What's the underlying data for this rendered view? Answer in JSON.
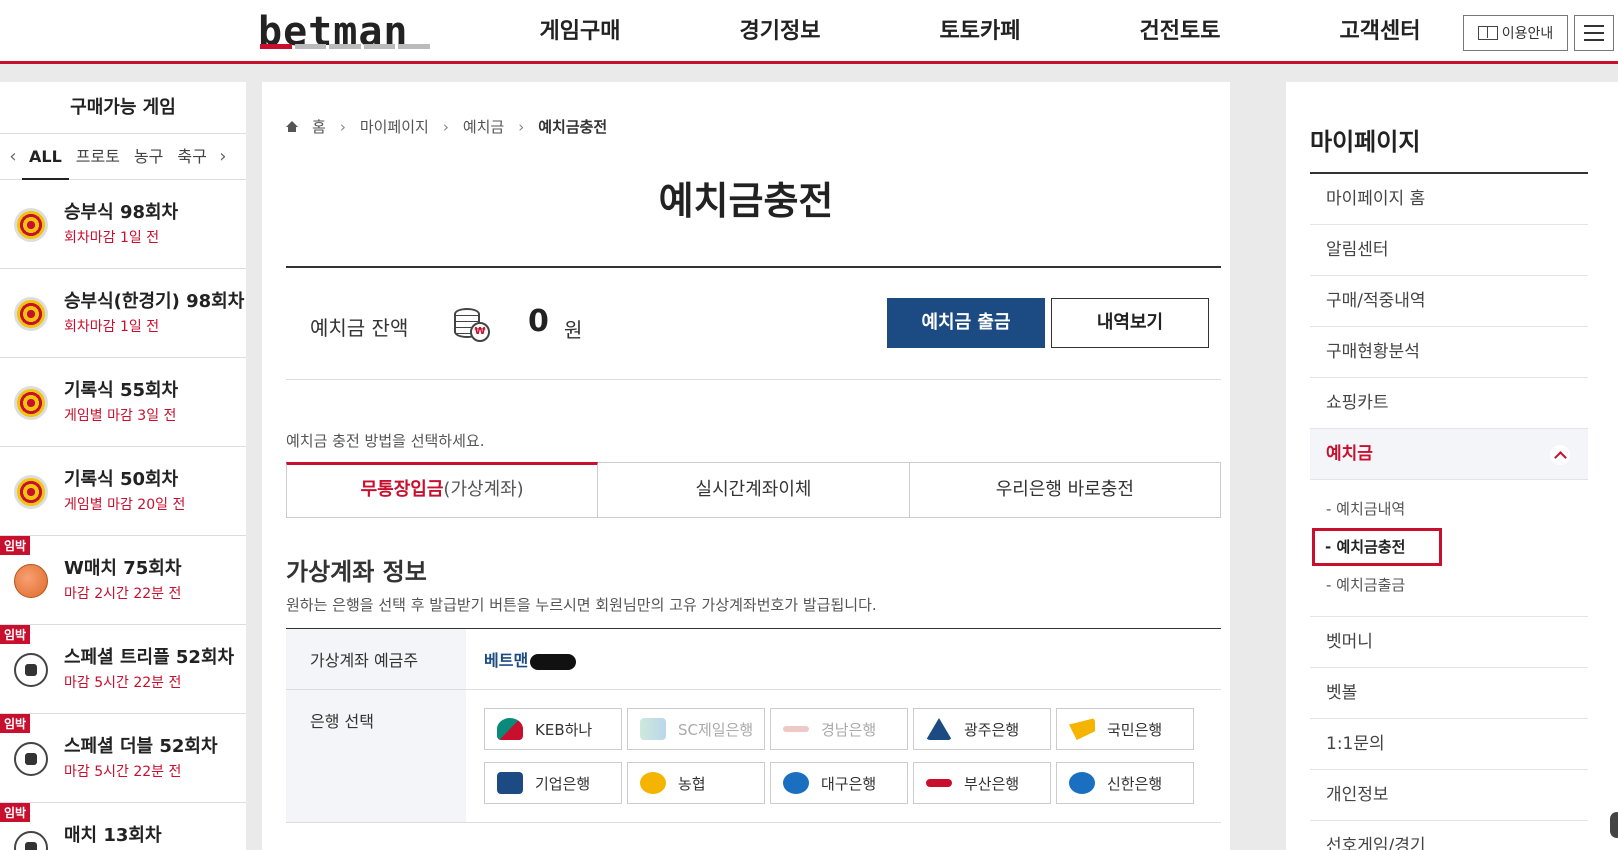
{
  "header": {
    "logo": "betman",
    "nav": [
      "게임구매",
      "경기정보",
      "토토카페",
      "건전토토",
      "고객센터"
    ],
    "guide_label": "이용안내"
  },
  "left_sidebar": {
    "title": "구매가능 게임",
    "tabs": [
      "ALL",
      "프로토",
      "농구",
      "축구"
    ],
    "active_tab": "ALL",
    "games": [
      {
        "name": "승부식 98회차",
        "deadline": "회차마감 1일 전",
        "icon": "target-icon",
        "badge": ""
      },
      {
        "name": "승부식(한경기) 98회차",
        "deadline": "회차마감 1일 전",
        "icon": "target-icon",
        "badge": ""
      },
      {
        "name": "기록식 55회차",
        "deadline": "게임별 마감 3일 전",
        "icon": "target-icon",
        "badge": ""
      },
      {
        "name": "기록식 50회차",
        "deadline": "게임별 마감 20일 전",
        "icon": "target-icon",
        "badge": ""
      },
      {
        "name": "W매치 75회차",
        "deadline": "마감 2시간 22분 전",
        "icon": "basketball-icon",
        "badge": "임박"
      },
      {
        "name": "스페셜 트리플 52회차",
        "deadline": "마감 5시간 22분 전",
        "icon": "soccer-ball-icon",
        "badge": "임박"
      },
      {
        "name": "스페셜 더블 52회차",
        "deadline": "마감 5시간 22분 전",
        "icon": "soccer-ball-icon",
        "badge": "임박"
      },
      {
        "name": "매치 13회차",
        "deadline": "",
        "icon": "soccer-ball-icon",
        "badge": "임박"
      }
    ]
  },
  "main": {
    "breadcrumb": [
      "홈",
      "마이페이지",
      "예치금",
      "예치금충전"
    ],
    "title": "예치금충전",
    "balance": {
      "label": "예치금 잔액",
      "amount": "0",
      "unit": "원",
      "withdraw_label": "예치금 출금",
      "history_label": "내역보기"
    },
    "method_prompt": "예치금 충전 방법을 선택하세요.",
    "method_tabs": [
      {
        "label": "무통장입금",
        "sub": "(가상계좌)",
        "active": true
      },
      {
        "label": "실시간계좌이체",
        "sub": "",
        "active": false
      },
      {
        "label": "우리은행 바로충전",
        "sub": "",
        "active": false
      }
    ],
    "section_title": "가상계좌 정보",
    "section_desc": "원하는 은행을 선택 후 발급받기 버튼을 누르시면 회원님만의 고유 가상계좌번호가 발급됩니다.",
    "holder_label": "가상계좌 예금주",
    "holder_name": "베트맨",
    "bank_label": "은행 선택",
    "banks": [
      {
        "name": "KEB하나",
        "disabled": false
      },
      {
        "name": "SC제일은행",
        "disabled": true
      },
      {
        "name": "경남은행",
        "disabled": true
      },
      {
        "name": "광주은행",
        "disabled": false
      },
      {
        "name": "국민은행",
        "disabled": false
      },
      {
        "name": "기업은행",
        "disabled": false
      },
      {
        "name": "농협",
        "disabled": false
      },
      {
        "name": "대구은행",
        "disabled": false
      },
      {
        "name": "부산은행",
        "disabled": false
      },
      {
        "name": "신한은행",
        "disabled": false
      }
    ]
  },
  "right_sidebar": {
    "title": "마이페이지",
    "items_top": [
      "마이페이지 홈",
      "알림센터",
      "구매/적중내역",
      "구매현황분석",
      "쇼핑카트"
    ],
    "open_item": "예치금",
    "sub_items": [
      "- 예치금내역",
      "- 예치금충전",
      "- 예치금출금"
    ],
    "current_sub": "- 예치금충전",
    "items_bottom": [
      "벳머니",
      "벳볼",
      "1:1문의",
      "개인정보",
      "선호게임/경기"
    ]
  }
}
